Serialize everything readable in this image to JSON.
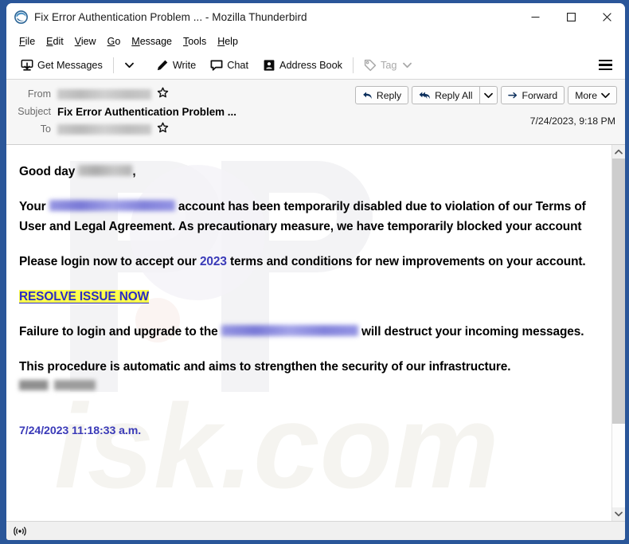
{
  "window": {
    "title": "Fix Error Authentication Problem ... - Mozilla Thunderbird",
    "logo_icon": "thunderbird-logo-icon",
    "controls": {
      "minimize": "minimize-icon",
      "maximize": "maximize-icon",
      "close": "close-icon"
    },
    "border_color": "#2a5699"
  },
  "menubar": {
    "items": [
      {
        "label": "File",
        "accel": "F"
      },
      {
        "label": "Edit",
        "accel": "E"
      },
      {
        "label": "View",
        "accel": "V"
      },
      {
        "label": "Go",
        "accel": "G"
      },
      {
        "label": "Message",
        "accel": "M"
      },
      {
        "label": "Tools",
        "accel": "T"
      },
      {
        "label": "Help",
        "accel": "H"
      }
    ]
  },
  "toolbar": {
    "get_messages": "Get Messages",
    "get_messages_icon": "download-mail-icon",
    "get_messages_chevron": "chevron-down-icon",
    "write": "Write",
    "write_icon": "pencil-icon",
    "chat": "Chat",
    "chat_icon": "speech-bubble-icon",
    "address_book": "Address Book",
    "address_book_icon": "address-book-icon",
    "tag": "Tag",
    "tag_icon": "tag-icon",
    "tag_chevron": "chevron-down-icon",
    "tag_disabled": true,
    "app_menu_icon": "hamburger-menu-icon"
  },
  "message_header": {
    "from_label": "From",
    "from_value": "",
    "from_redacted": true,
    "from_star_icon": "star-outline-icon",
    "subject_label": "Subject",
    "subject_value": "Fix Error Authentication Problem ...",
    "to_label": "To",
    "to_value": "",
    "to_redacted": true,
    "to_star_icon": "star-outline-icon",
    "date": "7/24/2023, 9:18 PM",
    "actions": {
      "reply": "Reply",
      "reply_icon": "reply-arrow-icon",
      "reply_all": "Reply All",
      "reply_all_icon": "reply-all-arrow-icon",
      "reply_all_chevron": "chevron-down-icon",
      "forward": "Forward",
      "forward_icon": "forward-arrow-icon",
      "more": "More",
      "more_chevron": "chevron-down-icon"
    }
  },
  "body": {
    "greeting_prefix": "Good day",
    "greeting_suffix": ",",
    "p1_a": "Your",
    "p1_b": "account has been temporarily disabled due to violation of our Terms of User and Legal Agreement. As precautionary measure, we have temporarily blocked your account",
    "p2_a": "Please login now to accept our",
    "p2_year": "2023",
    "p2_b": "terms and conditions for new improvements on your account.",
    "resolve_link": "RESOLVE ISSUE NOW",
    "p3_a": "Failure to login  and upgrade to the",
    "p3_b": "will destruct your incoming messages.",
    "p4": "This procedure is automatic and aims to strengthen the security of our infrastructure.",
    "final_date": "7/24/2023 11:18:33 a.m.",
    "link_color": "#3a3ab8",
    "highlight_color": "#ffff4d"
  },
  "scrollbar": {
    "up_icon": "chevron-up-icon",
    "down_icon": "chevron-down-icon"
  },
  "statusbar": {
    "icon": "rss-broadcast-icon"
  }
}
